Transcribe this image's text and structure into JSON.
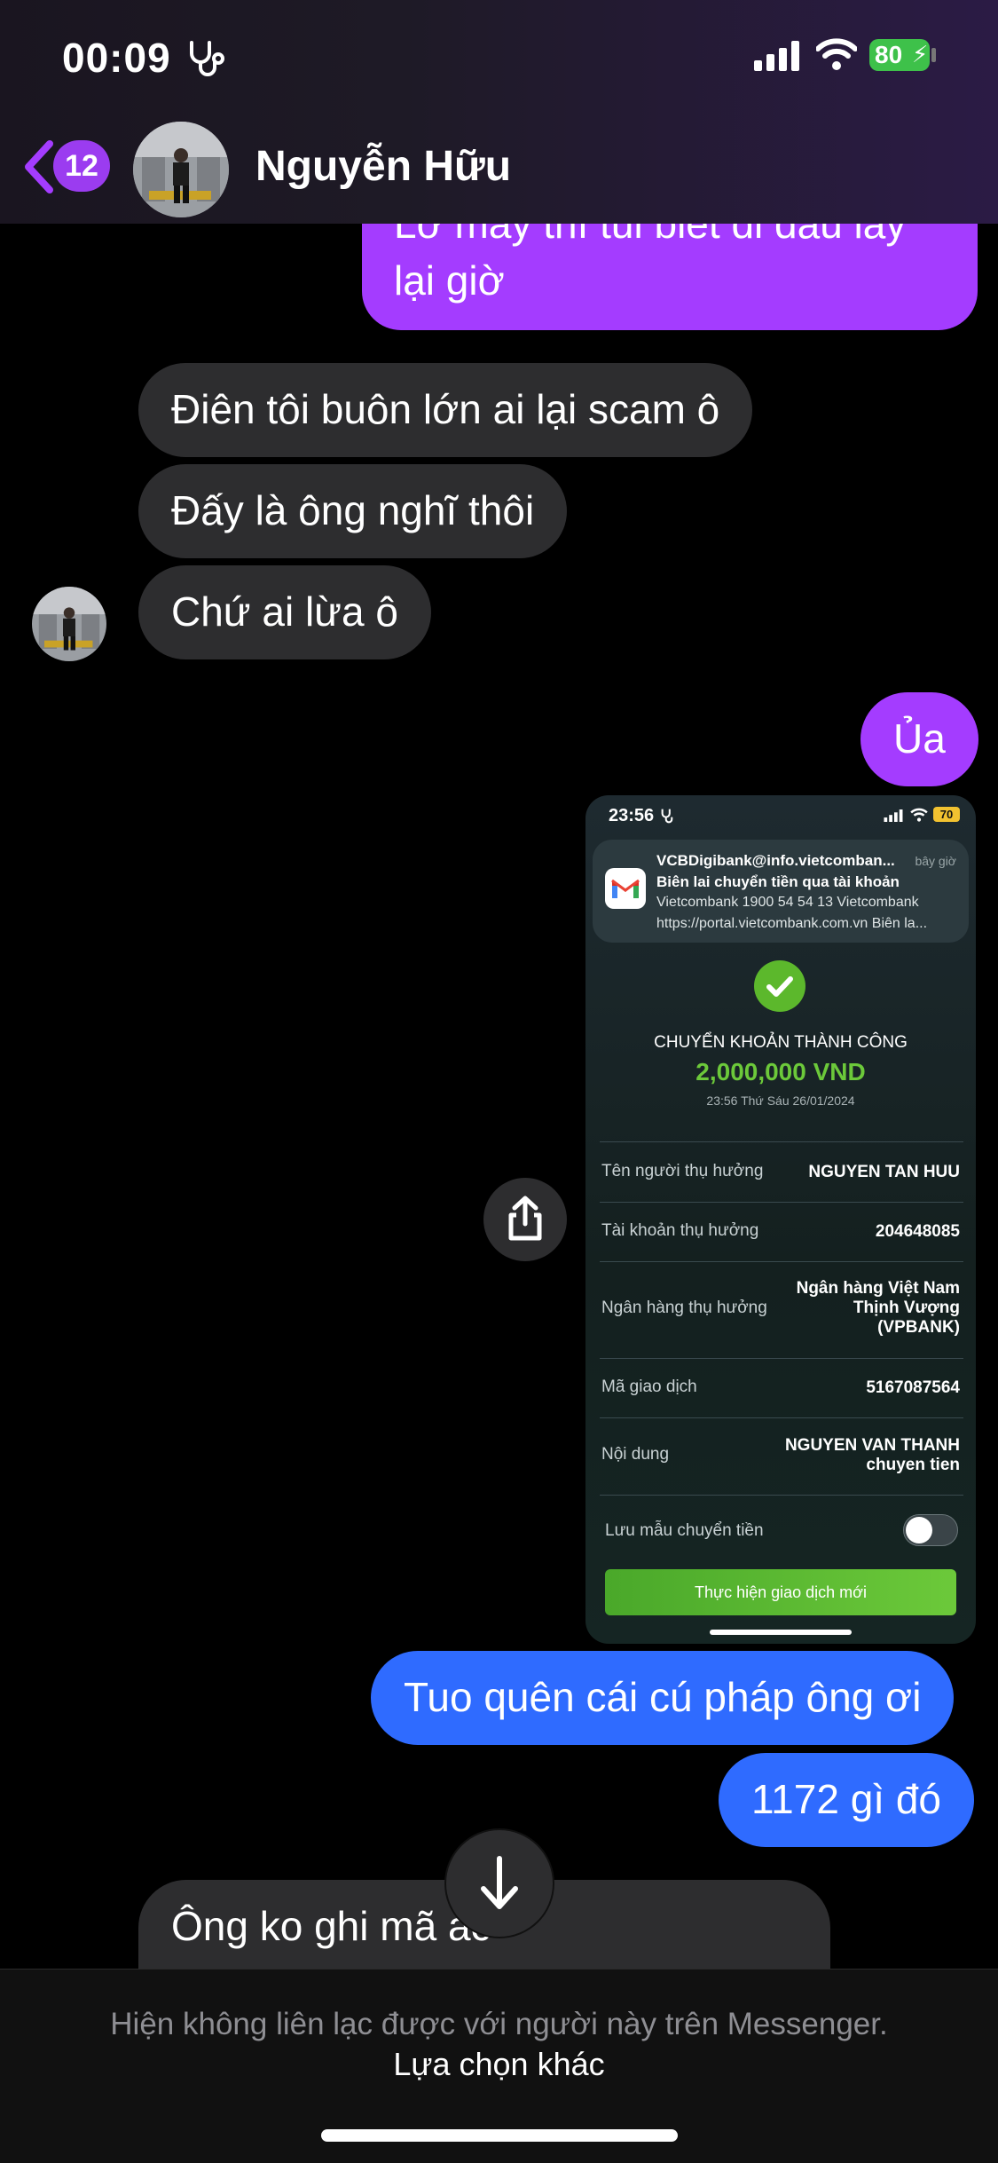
{
  "status_bar": {
    "time": "00:09",
    "battery": "80"
  },
  "header": {
    "back_count": "12",
    "contact_name": "Nguyễn Hữu"
  },
  "messages": {
    "top_partial_line1": "Lỡ mày thì tui biết đi đâu lấy",
    "top_partial_line2": "lại giờ",
    "recv_1": "Điên tôi buôn lớn ai lại scam ô",
    "recv_2": "Đấy là ông nghĩ thôi",
    "recv_3": "Chứ ai lừa ô",
    "sent_1": "Ủa",
    "sent_2": "Tuo quên cái cú pháp ông ơi",
    "sent_3": "1172 gì đó",
    "recv_4": "Ông ko ghi mã ắc"
  },
  "receipt": {
    "time": "23:56",
    "battery": "70",
    "notif_sender": "VCBDigibank@info.vietcomban...",
    "notif_when": "bây giờ",
    "notif_title": "Biên lai chuyển tiền qua tài khoản",
    "notif_line2": "Vietcombank 1900 54 54 13 Vietcombank",
    "notif_line3": "https://portal.vietcombank.com.vn Biên la...",
    "status": "CHUYỂN KHOẢN THÀNH CÔNG",
    "amount": "2,000,000 VND",
    "datetime": "23:56 Thứ Sáu 26/01/2024",
    "rows": [
      {
        "label": "Tên người thụ hưởng",
        "value": "NGUYEN TAN HUU"
      },
      {
        "label": "Tài khoản thụ hưởng",
        "value": "204648085"
      },
      {
        "label": "Ngân hàng thụ hưởng",
        "value_l1": "Ngân hàng  Việt Nam",
        "value_l2": "Thịnh Vượng",
        "value_l3": "(VPBANK)"
      },
      {
        "label": "Mã giao dịch",
        "value": "5167087564"
      },
      {
        "label": "Nội dung",
        "value_l1": "NGUYEN VAN THANH",
        "value_l2": "chuyen tien"
      }
    ],
    "save_template_label": "Lưu mẫu chuyển tiền",
    "new_txn_button": "Thực hiện giao dịch mới"
  },
  "bottom": {
    "notice": "Hiện không liên lạc được với người này trên Messenger.",
    "other_options": "Lựa chọn khác"
  },
  "colors": {
    "accent_purple": "#a43cff",
    "sent_blue": "#2f6bff",
    "received_gray": "#2d2d2f",
    "vcb_green": "#5cb82c"
  },
  "icons": [
    "stethoscope-icon",
    "signal-icon",
    "wifi-icon",
    "battery-icon",
    "back-chevron-icon",
    "share-icon",
    "scroll-down-arrow-icon",
    "gmail-icon",
    "check-icon"
  ]
}
